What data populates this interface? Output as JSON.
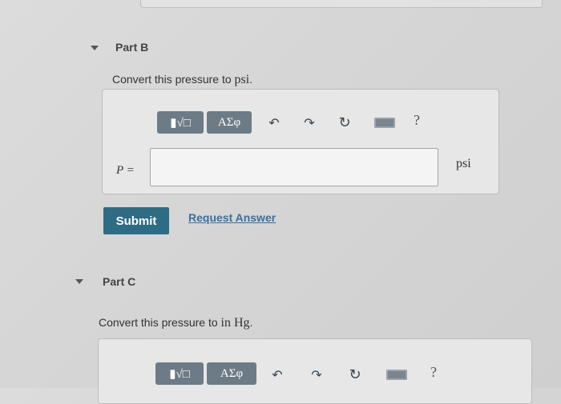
{
  "partB": {
    "title": "Part B",
    "prompt_prefix": "Convert this pressure to ",
    "prompt_unit": "psi",
    "prompt_suffix": ".",
    "toolbar": {
      "math_button": "▮√□",
      "greek_button": "ΑΣφ",
      "undo_icon": "↶",
      "redo_icon": "↷",
      "reset_icon": "↻",
      "help_label": "?"
    },
    "variable_label": "P =",
    "input_value": "",
    "unit_label": "psi",
    "submit_label": "Submit",
    "request_label": "Request Answer"
  },
  "partC": {
    "title": "Part C",
    "prompt_prefix": "Convert this pressure to ",
    "prompt_unit": "in Hg",
    "prompt_suffix": ".",
    "toolbar": {
      "math_button": "▮√□",
      "greek_button": "ΑΣφ",
      "undo_icon": "↶",
      "redo_icon": "↷",
      "reset_icon": "↻",
      "help_label": "?"
    }
  }
}
